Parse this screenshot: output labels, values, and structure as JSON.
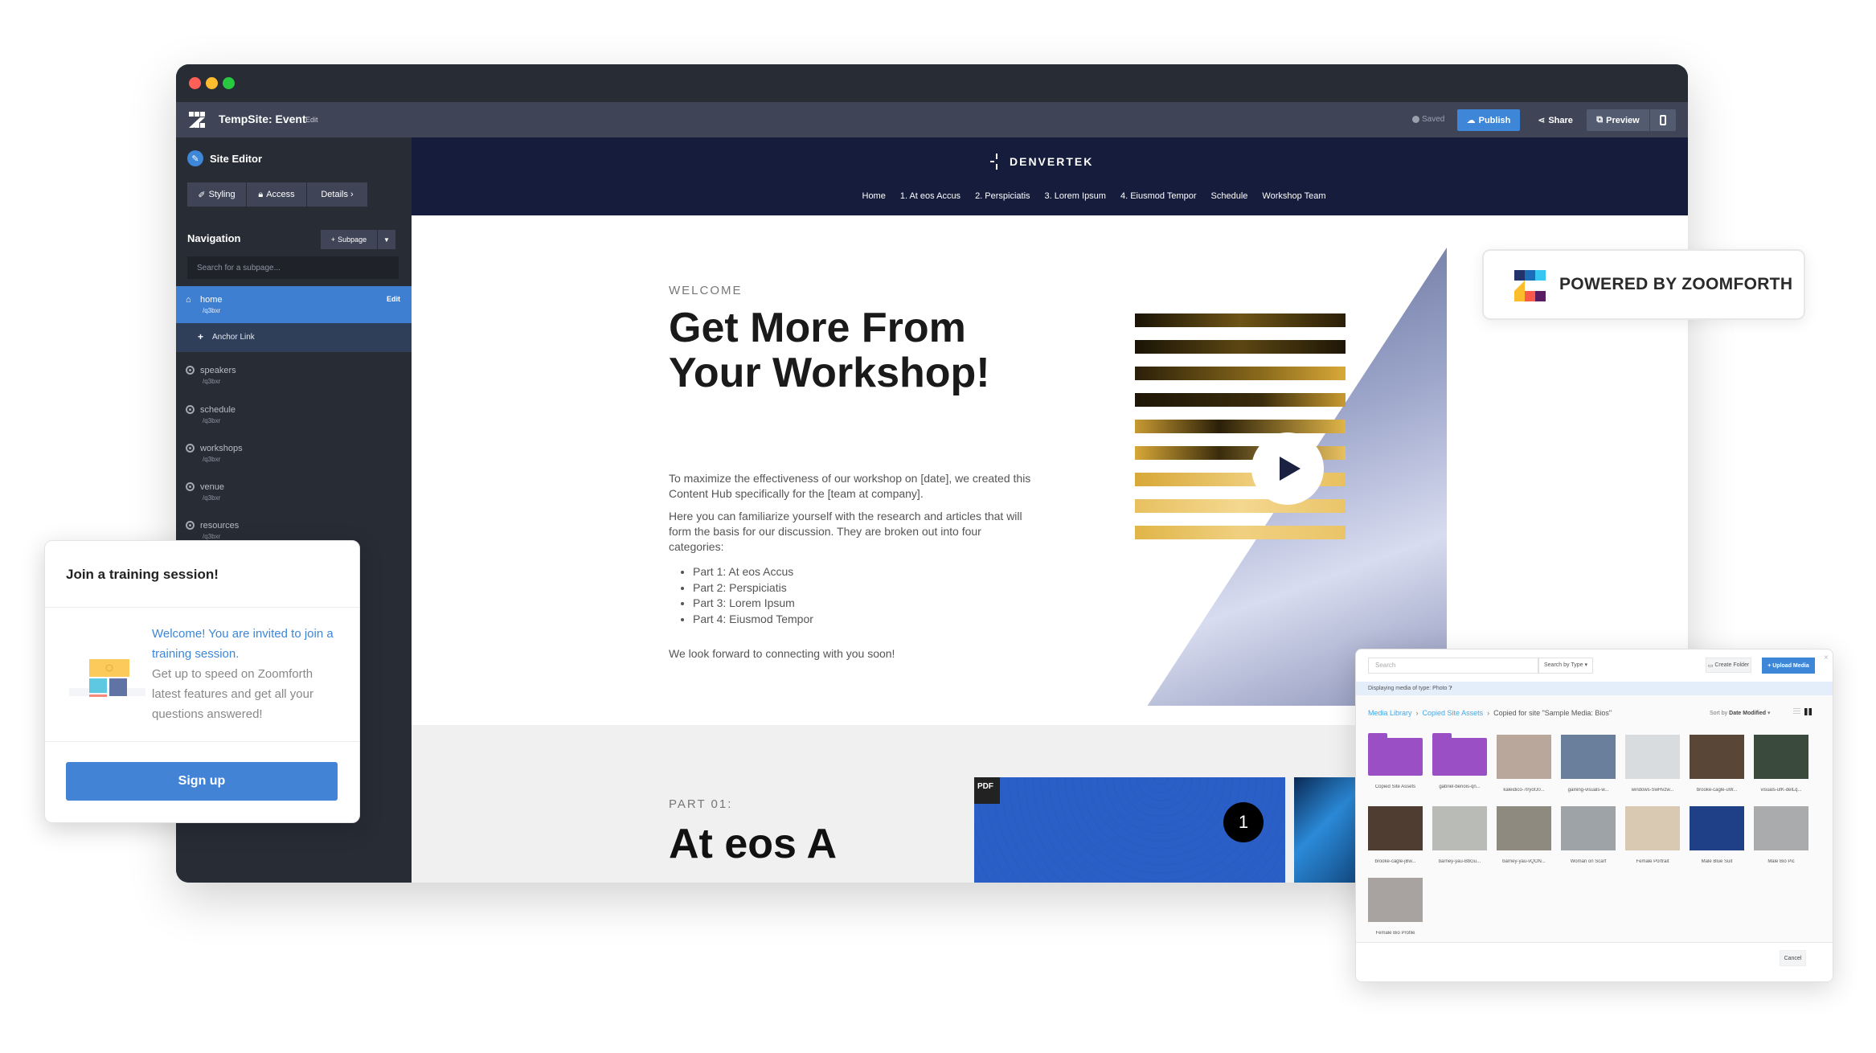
{
  "window": {
    "app_title": "TempSite: Event",
    "app_edit_label": "Edit",
    "saved_label": "Saved",
    "publish_label": "Publish",
    "share_label": "Share",
    "preview_label": "Preview"
  },
  "sidebar": {
    "title": "Site Editor",
    "tabs": [
      {
        "label": "Styling",
        "icon": "brush-icon"
      },
      {
        "label": "Access",
        "icon": "lock-icon"
      },
      {
        "label": "Details ›",
        "icon": ""
      }
    ],
    "navigation_label": "Navigation",
    "subpage_button": "Subpage",
    "search_placeholder": "Search for a subpage...",
    "active_item": {
      "label": "home",
      "path": "/q3bxr",
      "edit_label": "Edit"
    },
    "anchor_link_label": "Anchor Link",
    "items": [
      {
        "label": "speakers",
        "path": "/q3bxr"
      },
      {
        "label": "schedule",
        "path": "/q3bxr"
      },
      {
        "label": "workshops",
        "path": "/q3bxr"
      },
      {
        "label": "venue",
        "path": "/q3bxr"
      },
      {
        "label": "resources",
        "path": "/q3bxr"
      }
    ]
  },
  "site": {
    "brand": "DENVERTEK",
    "nav": [
      "Home",
      "1. At eos Accus",
      "2. Perspiciatis",
      "3. Lorem Ipsum",
      "4. Eiusmod Tempor",
      "Schedule",
      "Workshop Team"
    ],
    "hero": {
      "eyebrow": "WELCOME",
      "title": "Get More From Your Workshop!",
      "paragraph1": "To maximize the effectiveness of our workshop on [date], we created this Content Hub specifically for the [team at company].",
      "paragraph2": "Here you can familiarize yourself with the research and articles that will form the basis for our discussion. They are broken out into four categories:",
      "list": [
        "Part 1: At eos Accus",
        "Part 2: Perspiciatis",
        "Part 3: Lorem Ipsum",
        "Part 4: Eiusmod Tempor"
      ],
      "closing": "We look forward to connecting with you soon!"
    },
    "section2": {
      "eyebrow": "PART 01:",
      "title": "At eos A",
      "pdf_badge": "PDF",
      "card_number": "1"
    }
  },
  "powered": {
    "text": "POWERED BY ZOOMFORTH"
  },
  "training": {
    "title": "Join a training session!",
    "lead": "Welcome! You are invited to join a training session.",
    "body": "Get up to speed on Zoomforth latest features and get all your questions answered!",
    "button": "Sign up"
  },
  "media": {
    "search_placeholder": "Search",
    "type_select": "Search by Type ▾",
    "create_folder": "Create Folder",
    "upload": "+ Upload Media",
    "info": "Displaying media of type: Photo",
    "breadcrumb": [
      "Media Library",
      "Copied Site Assets",
      "Copied for site \"Sample Media: Bios\""
    ],
    "sort_label": "Sort by",
    "sort_value": "Date Modified",
    "items": [
      {
        "caption": "Copied Site Assets",
        "type": "folder"
      },
      {
        "caption": "gabriel-benois-qn...",
        "type": "folder"
      },
      {
        "caption": "kaleidico-7lryofJ0...",
        "type": "photo",
        "color": "#b8a79a"
      },
      {
        "caption": "gaining-visuals-w...",
        "type": "photo",
        "color": "#6a7f9c"
      },
      {
        "caption": "windows-SwHvzw...",
        "type": "photo",
        "color": "#d9dcde"
      },
      {
        "caption": "brooke-cagle-uW...",
        "type": "photo",
        "color": "#5a4636"
      },
      {
        "caption": "visuals-ufK-delLq...",
        "type": "photo",
        "color": "#3a4a3c"
      },
      {
        "caption": "brooke-cagle-jBw...",
        "type": "photo",
        "color": "#4e3d30"
      },
      {
        "caption": "barney-yau-BbGu...",
        "type": "photo",
        "color": "#b9bcb6"
      },
      {
        "caption": "barney-yau-vQON...",
        "type": "photo",
        "color": "#8f8a80"
      },
      {
        "caption": "Woman on Scarf",
        "type": "photo",
        "color": "#9ea3a8"
      },
      {
        "caption": "Female Portrait",
        "type": "photo",
        "color": "#d9c8b2"
      },
      {
        "caption": "Male Blue Suit",
        "type": "photo",
        "color": "#1f3f86"
      },
      {
        "caption": "Male Bio Pic",
        "type": "photo",
        "color": "#a9abad"
      },
      {
        "caption": "Female Bio Profile",
        "type": "photo",
        "color": "#a8a2a0"
      }
    ],
    "cancel": "Cancel"
  }
}
